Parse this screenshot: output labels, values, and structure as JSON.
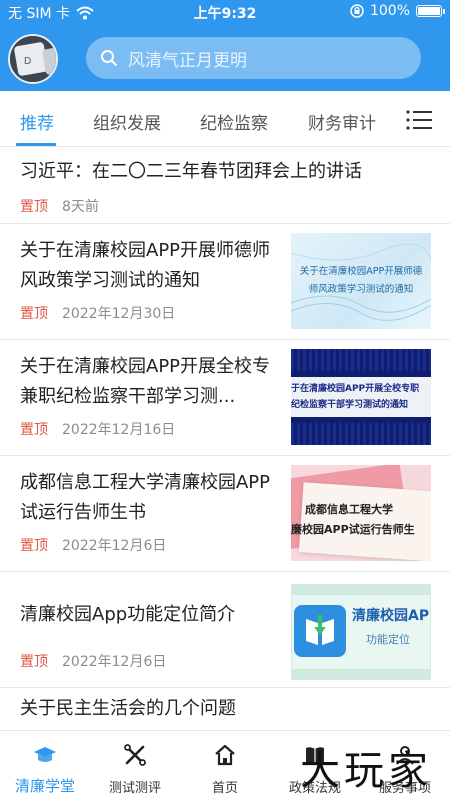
{
  "status_bar": {
    "carrier": "无 SIM 卡",
    "time": "上午9:32",
    "battery": "100%"
  },
  "header": {
    "search_placeholder": "风清气正月更明"
  },
  "tabs": [
    {
      "label": "推荐",
      "active": true
    },
    {
      "label": "组织发展"
    },
    {
      "label": "纪检监察"
    },
    {
      "label": "财务审计"
    }
  ],
  "list": [
    {
      "title": "习近平：在二〇二三年春节团拜会上的讲话",
      "pin": "置顶",
      "date": "8天前"
    },
    {
      "title": "关于在清廉校园APP开展师德师风政策学习测试的通知",
      "pin": "置顶",
      "date": "2022年12月30日",
      "thumb_text": "关于在清廉校园APP开展师德师风政策学习测试的通知"
    },
    {
      "title": "关于在清廉校园APP开展全校专兼职纪检监察干部学习测...",
      "pin": "置顶",
      "date": "2022年12月16日",
      "thumb_text_1": "于在清廉校园APP开展全校专职",
      "thumb_text_2": "纪检监察干部学习测试的通知"
    },
    {
      "title": "成都信息工程大学清廉校园APP试运行告师生书",
      "pin": "置顶",
      "date": "2022年12月6日",
      "thumb_text_1": "成都信息工程大学",
      "thumb_text_2": "廉校园APP试运行告师生"
    },
    {
      "title": "清廉校园App功能定位简介",
      "pin": "置顶",
      "date": "2022年12月6日",
      "thumb_text_1": "清廉校园API",
      "thumb_text_2": "功能定位"
    },
    {
      "title": "关于民主生活会的几个问题"
    }
  ],
  "bottom_nav": [
    {
      "label": "清廉学堂",
      "icon": "graduation-cap-icon",
      "active": true
    },
    {
      "label": "测试测评",
      "icon": "tools-icon"
    },
    {
      "label": "首页",
      "icon": "home-icon"
    },
    {
      "label": "政策法规",
      "icon": "book-icon"
    },
    {
      "label": "服务事项",
      "icon": "service-icon"
    }
  ],
  "watermark": "大玩家",
  "colors": {
    "accent": "#2f97ee",
    "pin": "#e25746",
    "date": "#8d8d8d"
  }
}
